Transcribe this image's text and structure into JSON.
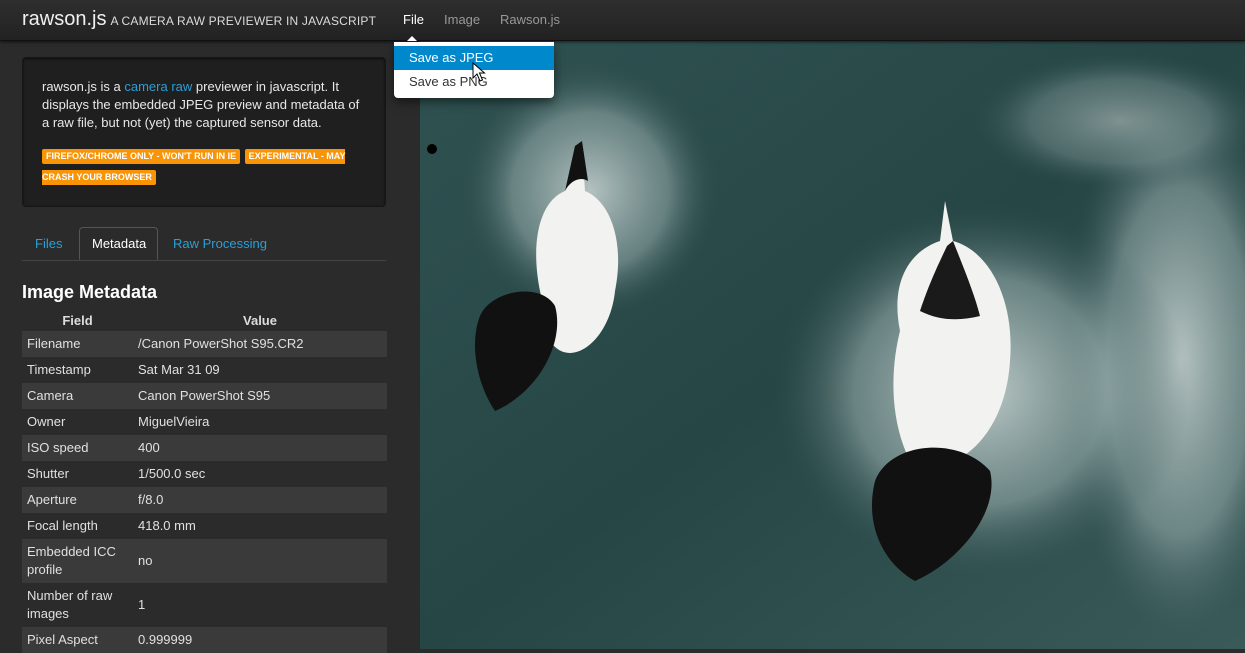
{
  "app": {
    "brand": "rawson.js",
    "tagline": "A CAMERA RAW PREVIEWER IN JAVASCRIPT"
  },
  "nav": {
    "items": [
      "File",
      "Image",
      "Rawson.js"
    ],
    "active": "File"
  },
  "file_menu": {
    "items": [
      "Save as JPEG",
      "Save as PNG"
    ],
    "highlighted": "Save as JPEG"
  },
  "intro": {
    "text_before": "rawson.js is a ",
    "link": "camera raw",
    "text_after": " previewer in javascript. It displays the embedded JPEG preview and metadata of a raw file, but not (yet) the captured sensor data."
  },
  "badges": [
    "FIREFOX/CHROME ONLY - WON'T RUN IN IE",
    "EXPERIMENTAL - MAY CRASH YOUR BROWSER"
  ],
  "tabs": {
    "items": [
      "Files",
      "Metadata",
      "Raw Processing"
    ],
    "active": "Metadata"
  },
  "metadata": {
    "title": "Image Metadata",
    "columns": [
      "Field",
      "Value"
    ],
    "rows": [
      {
        "field": "Filename",
        "value": "/Canon PowerShot S95.CR2"
      },
      {
        "field": "Timestamp",
        "value": "Sat Mar 31 09"
      },
      {
        "field": "Camera",
        "value": "Canon PowerShot S95"
      },
      {
        "field": "Owner",
        "value": "MiguelVieira"
      },
      {
        "field": "ISO speed",
        "value": "400"
      },
      {
        "field": "Shutter",
        "value": "1/500.0 sec"
      },
      {
        "field": "Aperture",
        "value": "f/8.0"
      },
      {
        "field": "Focal length",
        "value": "418.0 mm"
      },
      {
        "field": "Embedded ICC profile",
        "value": "no"
      },
      {
        "field": "Number of raw images",
        "value": "1"
      },
      {
        "field": "Pixel Aspect",
        "value": "0.999999"
      }
    ]
  },
  "colors": {
    "accent": "#2a9fd6",
    "badge": "#f89406",
    "menu_highlight": "#0088cc",
    "water": "#2c4d4e"
  }
}
